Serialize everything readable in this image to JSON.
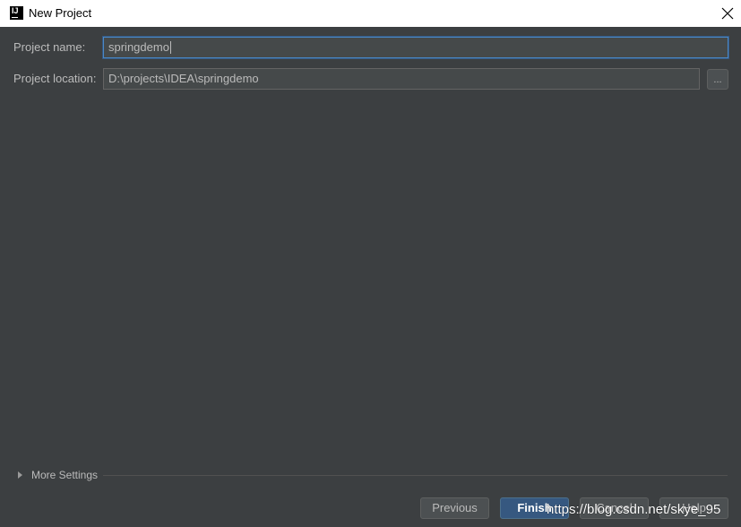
{
  "window": {
    "title": "New Project",
    "app_icon_text": "IJ"
  },
  "form": {
    "project_name_label": "Project name:",
    "project_name_value": "springdemo",
    "project_location_label": "Project location:",
    "project_location_value": "D:\\projects\\IDEA\\springdemo",
    "browse_label": "..."
  },
  "more_settings": {
    "label": "More Settings",
    "expanded": false
  },
  "buttons": {
    "previous": "Previous",
    "finish": "Finish",
    "cancel": "Cancel",
    "help": "Help"
  },
  "watermark": "https://blog.csdn.net/skye_95",
  "colors": {
    "background": "#3c3f41",
    "field_bg": "#45494a",
    "focus_border": "#4a88c7",
    "default_button": "#365880",
    "text": "#bbbbbb"
  }
}
